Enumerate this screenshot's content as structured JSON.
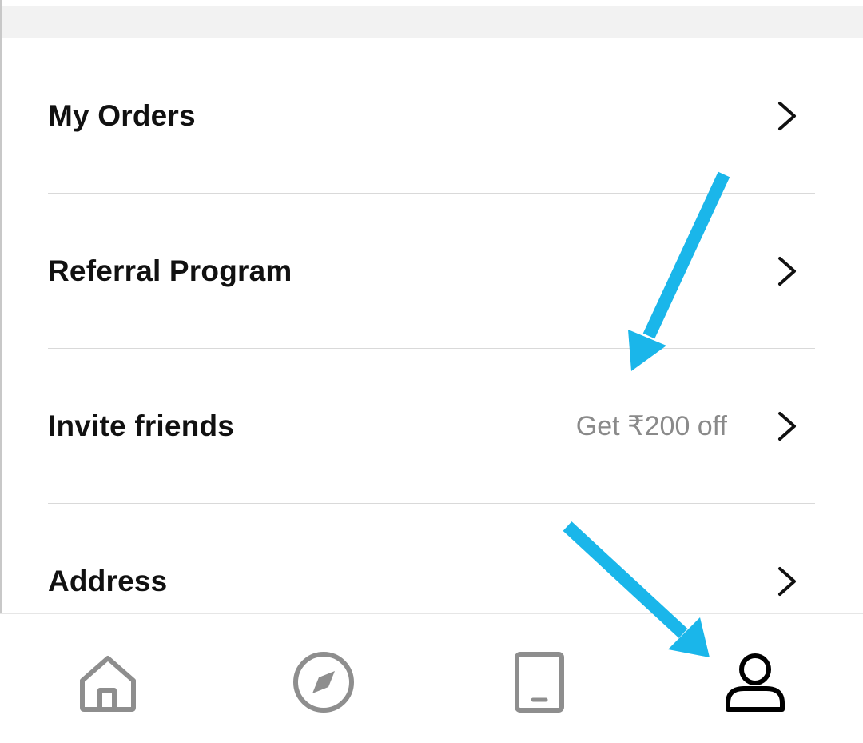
{
  "menu": {
    "items": [
      {
        "label": "My Orders",
        "hint": ""
      },
      {
        "label": "Referral Program",
        "hint": ""
      },
      {
        "label": "Invite friends",
        "hint": "Get ₹200 off"
      },
      {
        "label": "Address",
        "hint": ""
      }
    ]
  },
  "bottom_nav": {
    "items": [
      {
        "icon": "home-icon",
        "active": false
      },
      {
        "icon": "compass-icon",
        "active": false
      },
      {
        "icon": "tablet-icon",
        "active": false
      },
      {
        "icon": "profile-icon",
        "active": true
      }
    ]
  },
  "annotation": {
    "arrow_color": "#1ab6ea"
  },
  "colors": {
    "text": "#111111",
    "hint": "#8a8a8a",
    "inactive_icon": "#8e8e8e",
    "active_icon": "#000000",
    "divider": "#d9d9d9"
  }
}
